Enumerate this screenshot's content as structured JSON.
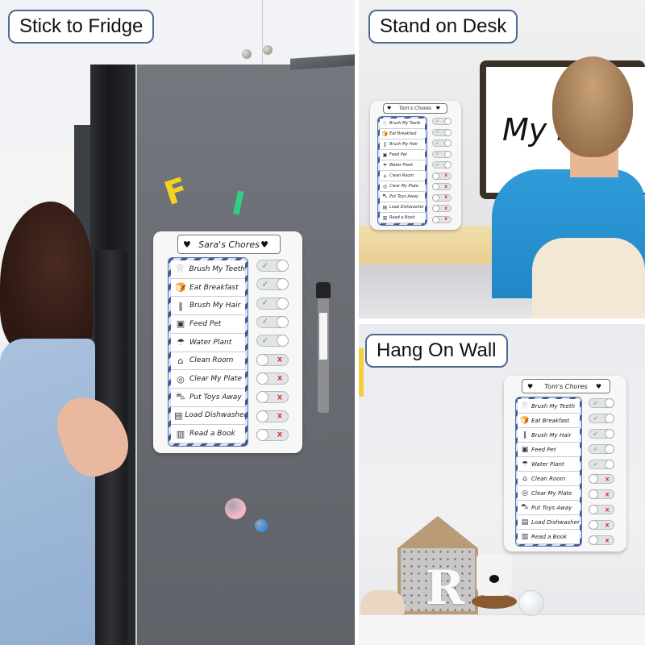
{
  "captions": {
    "fridge": "Stick to Fridge",
    "desk": "Stand on Desk",
    "wall": "Hang On Wall"
  },
  "magnets": {
    "letters": [
      "F",
      "I"
    ],
    "letter_colors": [
      "#f3d321",
      "#2ecf86"
    ],
    "dot_colors": [
      "#f6b7c8",
      "#3b8fe0"
    ]
  },
  "monitor_text": "My H",
  "boards": {
    "sara": {
      "title": "Sara's Chores",
      "chores": [
        {
          "icon": "tooth-icon",
          "glyph": "🦷",
          "label": "Brush My Teeth",
          "done": true
        },
        {
          "icon": "bread-icon",
          "glyph": "🍞",
          "label": "Eat Breakfast",
          "done": true
        },
        {
          "icon": "hairbrush-icon",
          "glyph": "‖",
          "label": "Brush My Hair",
          "done": true
        },
        {
          "icon": "pet-food-icon",
          "glyph": "▣",
          "label": "Feed Pet",
          "done": true
        },
        {
          "icon": "watering-can-icon",
          "glyph": "☂",
          "label": "Water Plant",
          "done": true
        },
        {
          "icon": "broom-icon",
          "glyph": "⌂",
          "label": "Clean Room",
          "done": false
        },
        {
          "icon": "plate-icon",
          "glyph": "◎",
          "label": "Clear My Plate",
          "done": false
        },
        {
          "icon": "toy-car-icon",
          "glyph": "⛍",
          "label": "Put Toys Away",
          "done": false
        },
        {
          "icon": "dishwasher-icon",
          "glyph": "▤",
          "label": "Load Dishwasher",
          "done": false
        },
        {
          "icon": "book-icon",
          "glyph": "▥",
          "label": "Read a Book",
          "done": false
        }
      ]
    },
    "tom": {
      "title": "Tom's Chores",
      "chores": [
        {
          "icon": "tooth-icon",
          "glyph": "🦷",
          "label": "Brush My Teeth",
          "done": true
        },
        {
          "icon": "bread-icon",
          "glyph": "🍞",
          "label": "Eat Breakfast",
          "done": true
        },
        {
          "icon": "hairbrush-icon",
          "glyph": "‖",
          "label": "Brush My Hair",
          "done": true
        },
        {
          "icon": "pet-food-icon",
          "glyph": "▣",
          "label": "Feed Pet",
          "done": true
        },
        {
          "icon": "watering-can-icon",
          "glyph": "☂",
          "label": "Water Plant",
          "done": true
        },
        {
          "icon": "broom-icon",
          "glyph": "⌂",
          "label": "Clean Room",
          "done": false
        },
        {
          "icon": "plate-icon",
          "glyph": "◎",
          "label": "Clear My Plate",
          "done": false
        },
        {
          "icon": "toy-car-icon",
          "glyph": "⛍",
          "label": "Put Toys Away",
          "done": false
        },
        {
          "icon": "dishwasher-icon",
          "glyph": "▤",
          "label": "Load Dishwasher",
          "done": false
        },
        {
          "icon": "book-icon",
          "glyph": "▥",
          "label": "Read a Book",
          "done": false
        }
      ]
    }
  },
  "marks": {
    "done": "✓",
    "todo": "x"
  },
  "heart": "♥",
  "house_letter": "R"
}
